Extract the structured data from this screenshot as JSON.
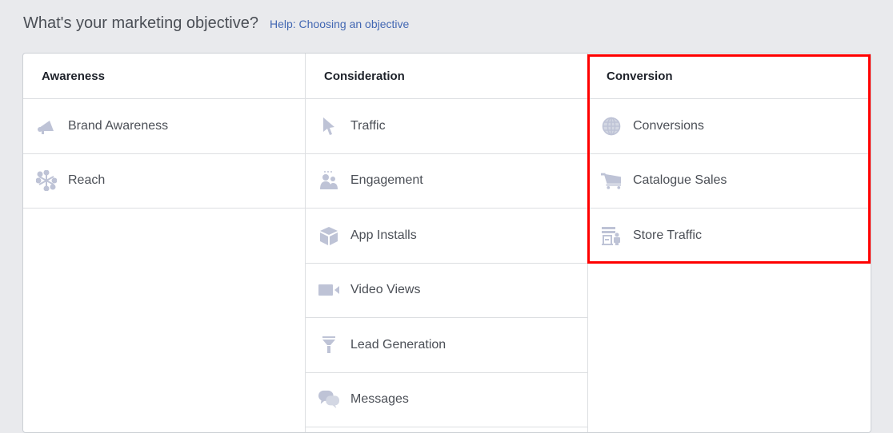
{
  "header": {
    "title": "What's your marketing objective?",
    "help_link": "Help: Choosing an objective"
  },
  "columns": [
    {
      "title": "Awareness",
      "items": [
        {
          "label": "Brand Awareness",
          "icon": "megaphone-icon"
        },
        {
          "label": "Reach",
          "icon": "reach-network-icon"
        }
      ]
    },
    {
      "title": "Consideration",
      "items": [
        {
          "label": "Traffic",
          "icon": "cursor-icon"
        },
        {
          "label": "Engagement",
          "icon": "people-icon"
        },
        {
          "label": "App Installs",
          "icon": "box-icon"
        },
        {
          "label": "Video Views",
          "icon": "video-camera-icon"
        },
        {
          "label": "Lead Generation",
          "icon": "funnel-icon"
        },
        {
          "label": "Messages",
          "icon": "chat-bubbles-icon"
        }
      ]
    },
    {
      "title": "Conversion",
      "items": [
        {
          "label": "Conversions",
          "icon": "globe-icon"
        },
        {
          "label": "Catalogue Sales",
          "icon": "shopping-cart-icon"
        },
        {
          "label": "Store Traffic",
          "icon": "store-icon"
        }
      ]
    }
  ],
  "colors": {
    "icon": "#bec3d6",
    "link": "#4267b2",
    "highlight": "#ff0000",
    "background": "#e9eaed"
  }
}
